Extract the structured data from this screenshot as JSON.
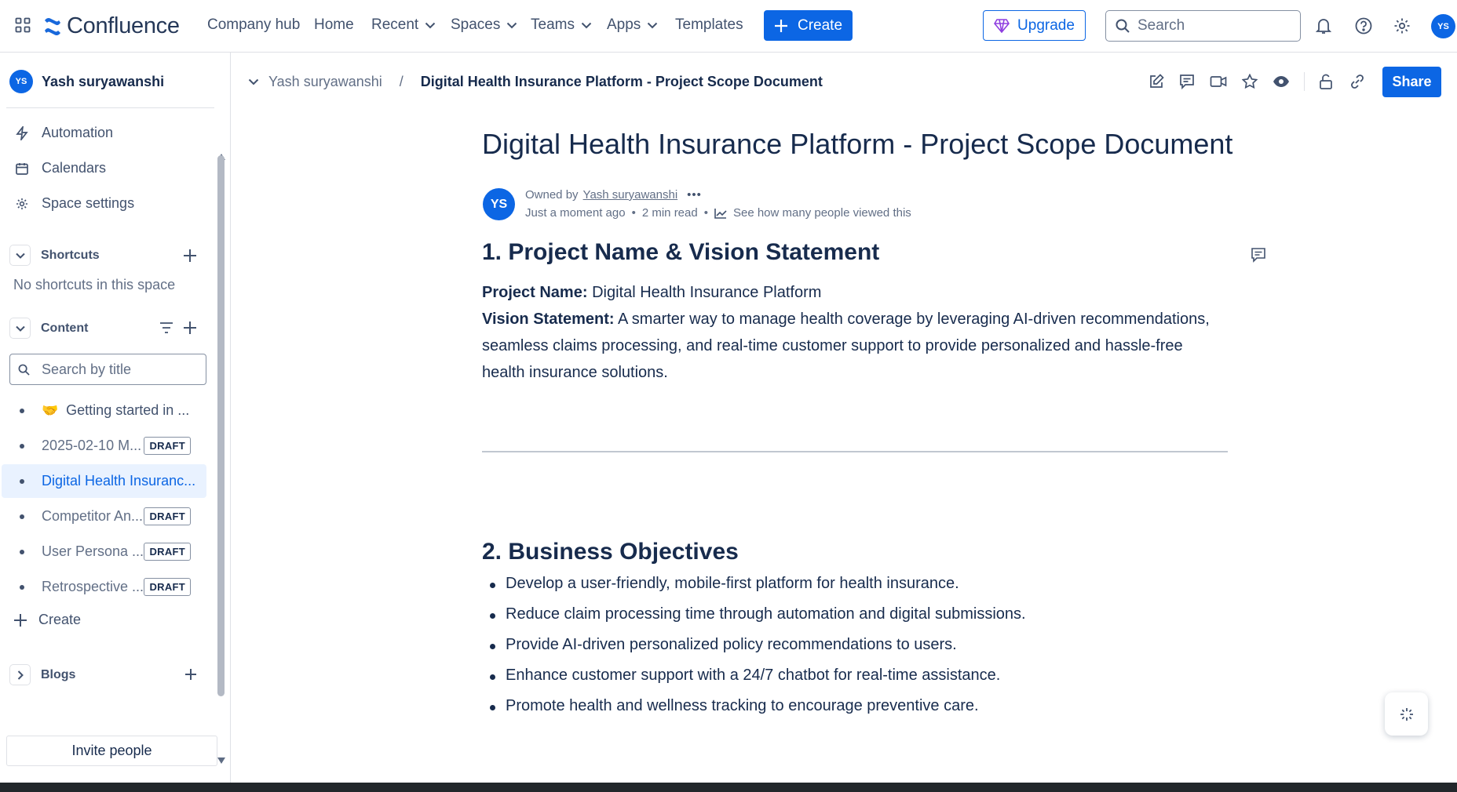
{
  "app": {
    "name": "Confluence",
    "brand_color": "#0c66e4"
  },
  "topnav": {
    "items": [
      {
        "label": "Company hub",
        "dropdown": false
      },
      {
        "label": "Home",
        "dropdown": false
      },
      {
        "label": "Recent",
        "dropdown": true
      },
      {
        "label": "Spaces",
        "dropdown": true
      },
      {
        "label": "Teams",
        "dropdown": true
      },
      {
        "label": "Apps",
        "dropdown": true
      },
      {
        "label": "Templates",
        "dropdown": false
      }
    ],
    "create_label": "Create",
    "upgrade_label": "Upgrade",
    "search_placeholder": "Search",
    "avatar_initials": "YS"
  },
  "sidebar": {
    "space_initials": "YS",
    "space_name": "Yash suryawanshi",
    "links": [
      "Automation",
      "Calendars",
      "Space settings"
    ],
    "shortcuts_label": "Shortcuts",
    "no_shortcuts": "No shortcuts in this space",
    "content_label": "Content",
    "search_placeholder": "Search by title",
    "tree": [
      {
        "emoji": "🤝",
        "label": "Getting started in ...",
        "draft": false
      },
      {
        "label": "2025-02-10 M...",
        "draft": true
      },
      {
        "label": "Digital Health Insuranc...",
        "draft": false,
        "active": true
      },
      {
        "label": "Competitor An...",
        "draft": true
      },
      {
        "label": "User Persona ...",
        "draft": true
      },
      {
        "label": "Retrospective ...",
        "draft": true
      }
    ],
    "draft_label": "DRAFT",
    "create_label": "Create",
    "blogs_label": "Blogs",
    "invite_label": "Invite people"
  },
  "breadcrumb": {
    "space": "Yash suryawanshi",
    "separator": "/",
    "page": "Digital Health Insurance Platform - Project Scope Document"
  },
  "toolbar": {
    "share_label": "Share"
  },
  "page": {
    "title": "Digital Health Insurance Platform - Project Scope Document",
    "owner_initials": "YS",
    "owned_by_label": "Owned by",
    "owner": "Yash suryawanshi",
    "more": "•••",
    "updated": "Just a moment ago",
    "dot": "•",
    "read_time": "2 min read",
    "views_link": "See how many people viewed this",
    "section1": {
      "heading": "1. Project Name & Vision Statement",
      "name_label": "Project Name:",
      "name_value": "Digital Health Insurance Platform",
      "vision_label": "Vision Statement:",
      "vision_value": "A smarter way to manage health coverage by leveraging AI-driven recommendations, seamless claims processing, and real-time customer support to provide personalized and hassle-free health insurance solutions."
    },
    "section2": {
      "heading": "2. Business Objectives",
      "items": [
        "Develop a user-friendly, mobile-first platform for health insurance.",
        "Reduce claim processing time through automation and digital submissions.",
        "Provide AI-driven personalized policy recommendations to users.",
        "Enhance customer support with a 24/7 chatbot for real-time assistance.",
        "Promote health and wellness tracking to encourage preventive care."
      ]
    }
  }
}
